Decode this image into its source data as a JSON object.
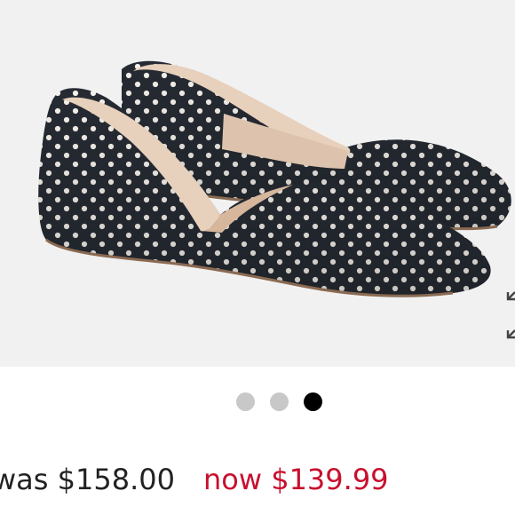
{
  "product": {
    "image_description": "polka-dot pointed-toe d'Orsay flats",
    "gallery": {
      "total": 3,
      "active_index": 2
    },
    "price": {
      "was_label": "was $158.00",
      "now_label": "now $139.99"
    }
  },
  "colors": {
    "page_background": "#ffffff",
    "photo_background": "#f1f1f1",
    "sale_price": "#c8102e",
    "regular_price": "#222222",
    "shoe_fabric": "#262b33",
    "shoe_dots": "#f4f0ea",
    "shoe_lining": "#e7d0bc",
    "dot_inactive": "#c8c8c8",
    "dot_active": "#000000"
  },
  "icons": {
    "expand": "expand-arrows-icon"
  }
}
